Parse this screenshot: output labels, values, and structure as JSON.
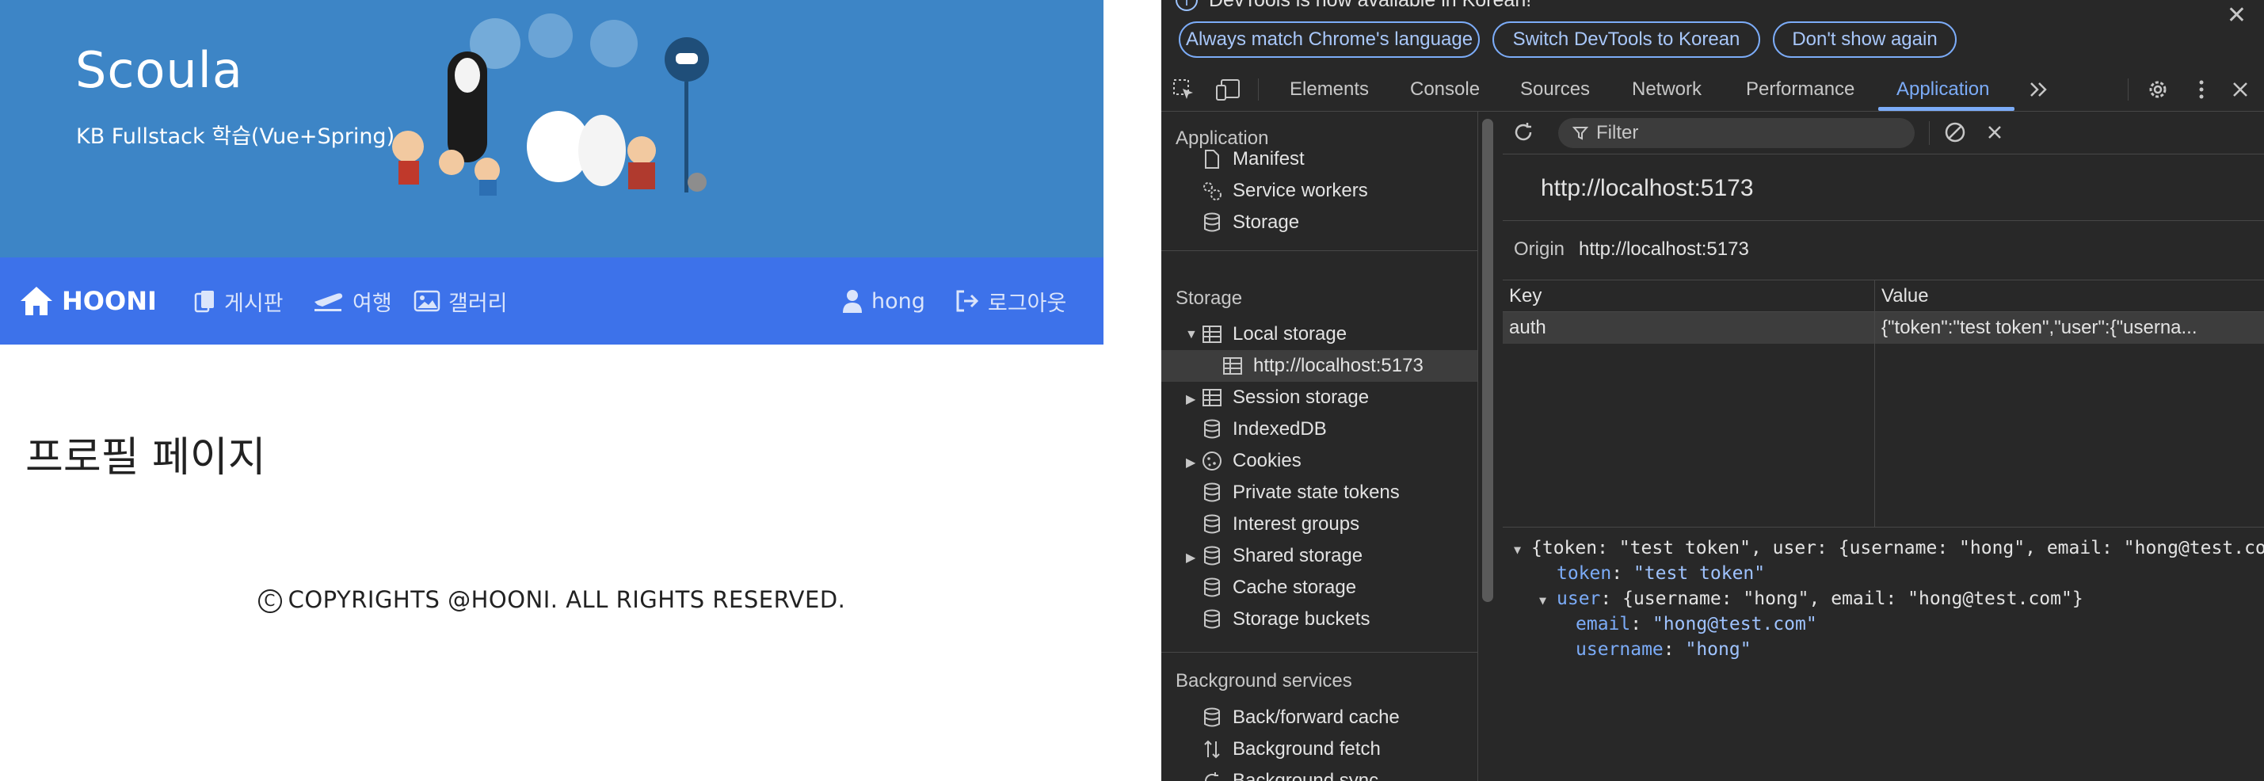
{
  "site": {
    "brand": "Scoula",
    "subtitle": "KB Fullstack 학습(Vue+Spring)",
    "nav": {
      "home": "HOONI",
      "board": "게시판",
      "travel": "여행",
      "gallery": "갤러리",
      "user": "hong",
      "logout": "로그아웃"
    },
    "main_title": "프로필 페이지",
    "footer": "COPYRIGHTS @HOONI. ALL RIGHTS RESERVED.",
    "colors": {
      "hero": "#3d85c6",
      "navbar": "#3d72ea"
    }
  },
  "devtools": {
    "infobar": {
      "text": "DevTools is now available in Korean!",
      "buttons": [
        "Always match Chrome's language",
        "Switch DevTools to Korean",
        "Don't show again"
      ]
    },
    "tabs": [
      "Elements",
      "Console",
      "Sources",
      "Network",
      "Performance",
      "Application"
    ],
    "active_tab": "Application",
    "sidebar": {
      "application_header": "Application",
      "application_items": [
        "Manifest",
        "Service workers",
        "Storage"
      ],
      "storage_header": "Storage",
      "storage_items": {
        "local_storage": "Local storage",
        "local_origin": "http://localhost:5173",
        "session_storage": "Session storage",
        "indexeddb": "IndexedDB",
        "cookies": "Cookies",
        "private_state_tokens": "Private state tokens",
        "interest_groups": "Interest groups",
        "shared_storage": "Shared storage",
        "cache_storage": "Cache storage",
        "storage_buckets": "Storage buckets"
      },
      "background_header": "Background services",
      "background_items": [
        "Back/forward cache",
        "Background fetch",
        "Background sync"
      ]
    },
    "panel": {
      "filter_placeholder": "Filter",
      "origin_title": "http://localhost:5173",
      "origin_label": "Origin",
      "origin_value": "http://localhost:5173",
      "columns": [
        "Key",
        "Value"
      ],
      "rows": [
        {
          "key": "auth",
          "value": "{\"token\":\"test token\",\"user\":{\"userna..."
        }
      ],
      "preview": {
        "line1": "{token: \"test token\", user: {username: \"hong\", email: \"hong@test.com\"}}",
        "token_key": "token",
        "token_value": "\"test token\"",
        "user_key": "user",
        "user_summary": "{username: \"hong\", email: \"hong@test.com\"}",
        "email_key": "email",
        "email_value": "\"hong@test.com\"",
        "username_key": "username",
        "username_value": "\"hong\""
      }
    }
  }
}
